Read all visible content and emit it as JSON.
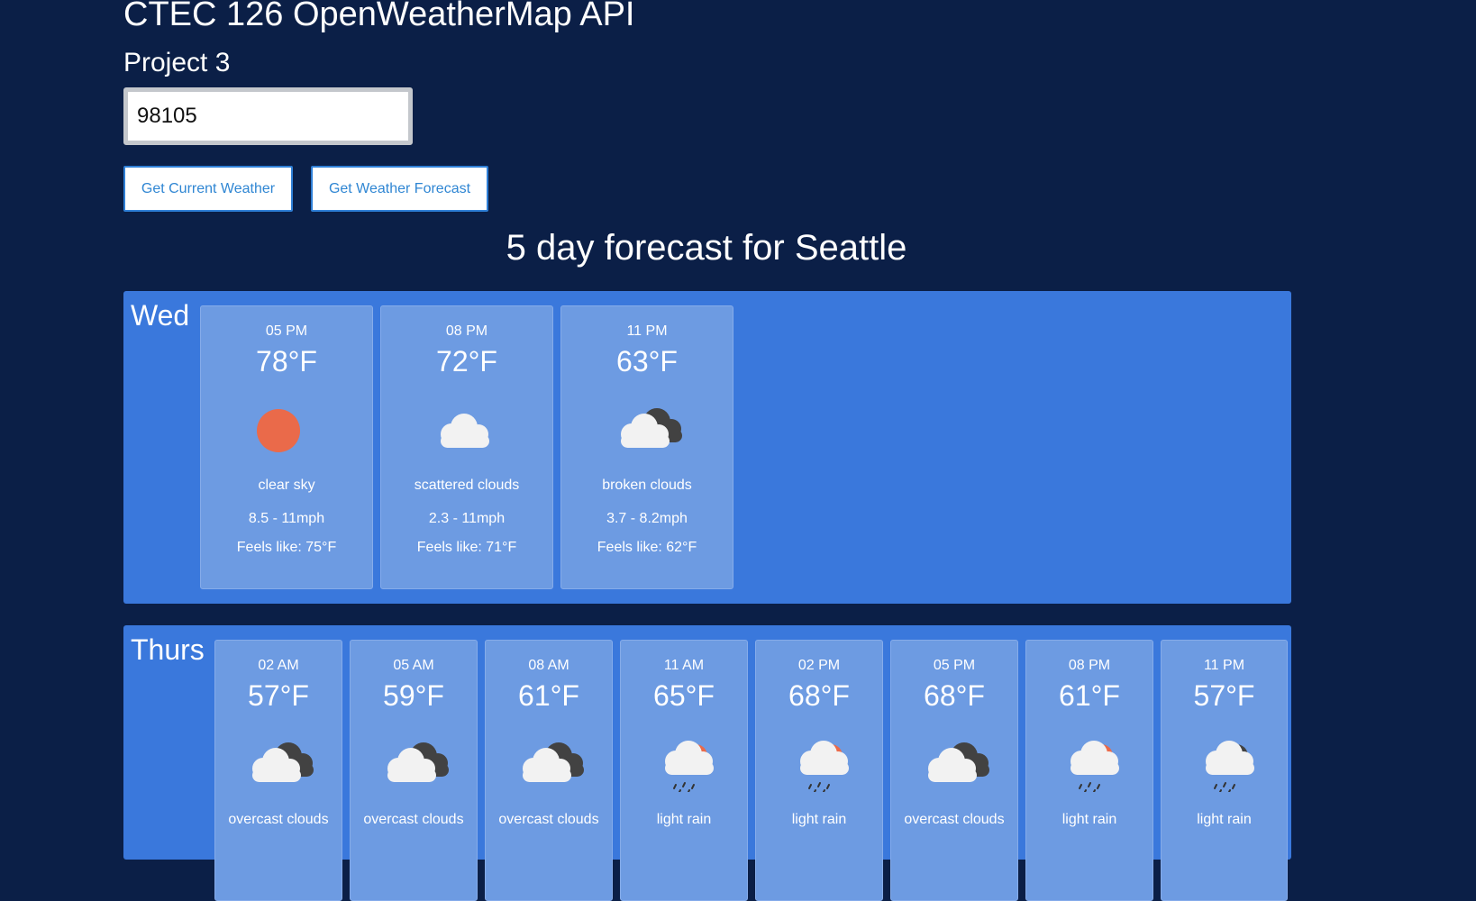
{
  "header": {
    "title": "CTEC 126 OpenWeatherMap API",
    "subtitle": "Project 3"
  },
  "search": {
    "zip_value": "98105"
  },
  "buttons": {
    "current": "Get Current Weather",
    "forecast": "Get Weather Forecast"
  },
  "forecast_heading": "5 day forecast for Seattle",
  "colors": {
    "page_background": "#0b1f47",
    "day_panel": "#3a78dc",
    "card": "#6d9be2",
    "button_text": "#2f86d3",
    "sun": "#ea6a4a",
    "cloud_light": "#f2f2f2",
    "cloud_dark": "#424242"
  },
  "days": [
    {
      "label": "Wed",
      "slots": [
        {
          "time": "05 PM",
          "temp": "78°F",
          "icon": "sun-icon",
          "desc": "clear sky",
          "wind": "8.5 - 11mph",
          "feels": "Feels like: 75°F"
        },
        {
          "time": "08 PM",
          "temp": "72°F",
          "icon": "cloud-icon",
          "desc": "scattered clouds",
          "wind": "2.3 - 11mph",
          "feels": "Feels like: 71°F"
        },
        {
          "time": "11 PM",
          "temp": "63°F",
          "icon": "broken-clouds-icon",
          "desc": "broken clouds",
          "wind": "3.7 - 8.2mph",
          "feels": "Feels like: 62°F"
        }
      ]
    },
    {
      "label": "Thurs",
      "slots": [
        {
          "time": "02 AM",
          "temp": "57°F",
          "icon": "overcast-clouds-icon",
          "desc": "overcast clouds"
        },
        {
          "time": "05 AM",
          "temp": "59°F",
          "icon": "overcast-clouds-icon",
          "desc": "overcast clouds"
        },
        {
          "time": "08 AM",
          "temp": "61°F",
          "icon": "overcast-clouds-icon",
          "desc": "overcast clouds"
        },
        {
          "time": "11 AM",
          "temp": "65°F",
          "icon": "rain-sun-icon",
          "desc": "light rain"
        },
        {
          "time": "02 PM",
          "temp": "68°F",
          "icon": "rain-sun-icon",
          "desc": "light rain"
        },
        {
          "time": "05 PM",
          "temp": "68°F",
          "icon": "overcast-clouds-icon",
          "desc": "overcast clouds"
        },
        {
          "time": "08 PM",
          "temp": "61°F",
          "icon": "rain-sun-icon",
          "desc": "light rain"
        },
        {
          "time": "11 PM",
          "temp": "57°F",
          "icon": "rain-night-icon",
          "desc": "light rain"
        }
      ]
    }
  ]
}
